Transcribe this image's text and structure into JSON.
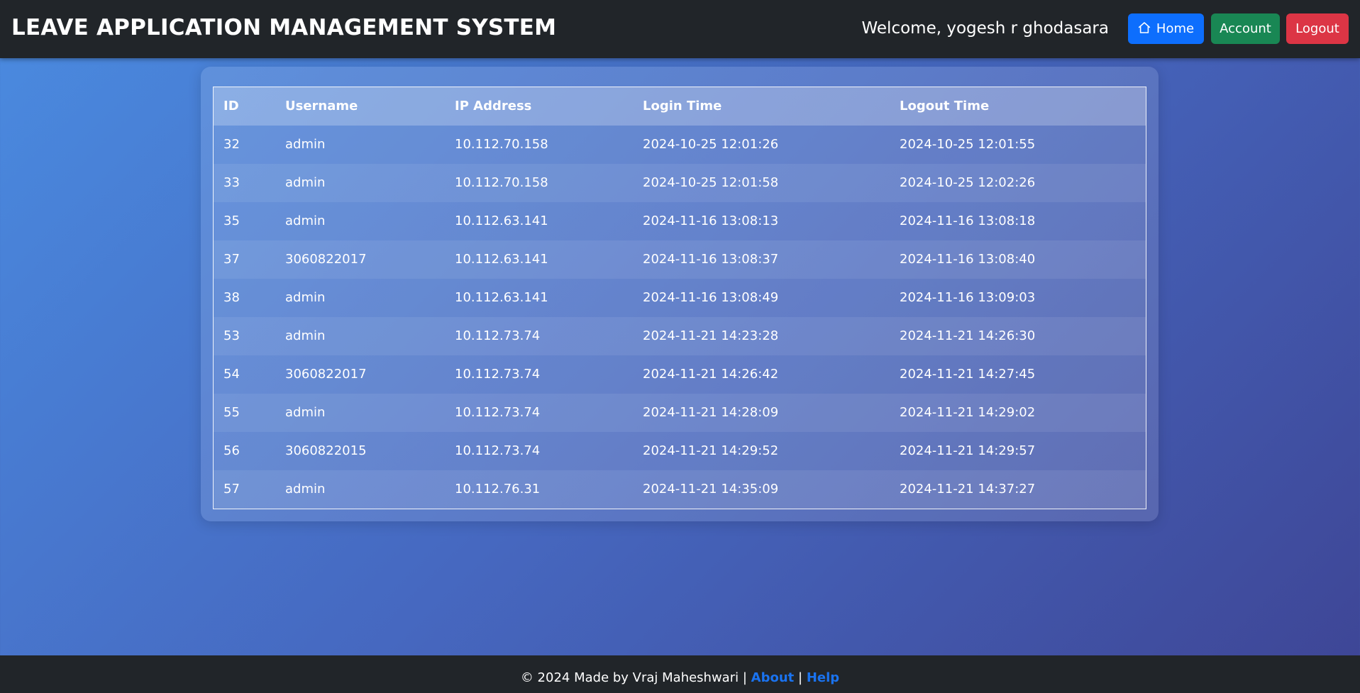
{
  "header": {
    "brand": "LEAVE APPLICATION MANAGEMENT SYSTEM",
    "welcome": "Welcome, yogesh r ghodasara",
    "buttons": {
      "home": "Home",
      "account": "Account",
      "logout": "Logout"
    }
  },
  "table": {
    "columns": [
      "ID",
      "Username",
      "IP Address",
      "Login Time",
      "Logout Time"
    ],
    "rows": [
      [
        "32",
        "admin",
        "10.112.70.158",
        "2024-10-25 12:01:26",
        "2024-10-25 12:01:55"
      ],
      [
        "33",
        "admin",
        "10.112.70.158",
        "2024-10-25 12:01:58",
        "2024-10-25 12:02:26"
      ],
      [
        "35",
        "admin",
        "10.112.63.141",
        "2024-11-16 13:08:13",
        "2024-11-16 13:08:18"
      ],
      [
        "37",
        "3060822017",
        "10.112.63.141",
        "2024-11-16 13:08:37",
        "2024-11-16 13:08:40"
      ],
      [
        "38",
        "admin",
        "10.112.63.141",
        "2024-11-16 13:08:49",
        "2024-11-16 13:09:03"
      ],
      [
        "53",
        "admin",
        "10.112.73.74",
        "2024-11-21 14:23:28",
        "2024-11-21 14:26:30"
      ],
      [
        "54",
        "3060822017",
        "10.112.73.74",
        "2024-11-21 14:26:42",
        "2024-11-21 14:27:45"
      ],
      [
        "55",
        "admin",
        "10.112.73.74",
        "2024-11-21 14:28:09",
        "2024-11-21 14:29:02"
      ],
      [
        "56",
        "3060822015",
        "10.112.73.74",
        "2024-11-21 14:29:52",
        "2024-11-21 14:29:57"
      ],
      [
        "57",
        "admin",
        "10.112.76.31",
        "2024-11-21 14:35:09",
        "2024-11-21 14:37:27"
      ]
    ]
  },
  "footer": {
    "text": "© 2024 Made by Vraj Maheshwari",
    "separator": "|",
    "about": "About",
    "help": "Help"
  },
  "colors": {
    "navbar": "#212529",
    "home_button": "#0d6efd",
    "account_button": "#198754",
    "logout_button": "#dc3545",
    "link": "#1a73f0"
  }
}
